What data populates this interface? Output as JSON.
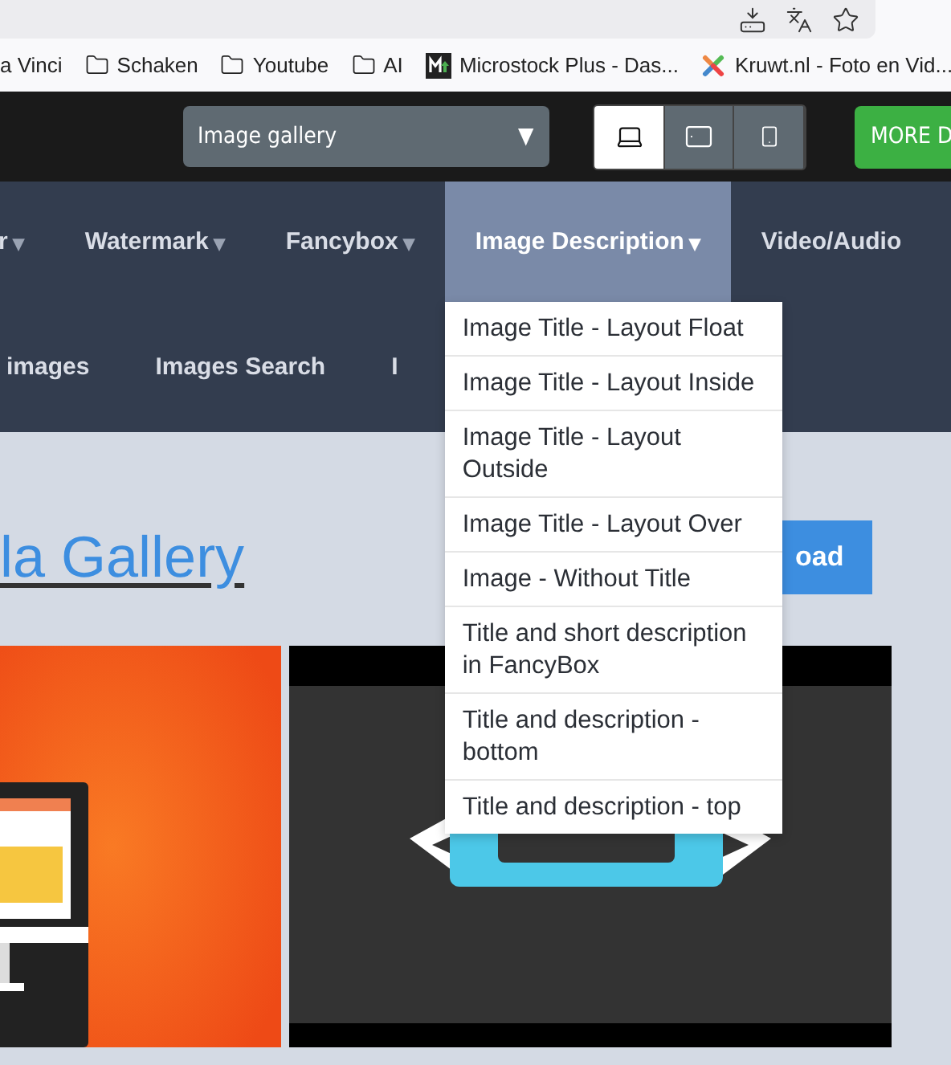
{
  "bookmarks": [
    {
      "kind": "text",
      "label": "a Vinci"
    },
    {
      "kind": "folder",
      "label": "Schaken"
    },
    {
      "kind": "folder",
      "label": "Youtube"
    },
    {
      "kind": "folder",
      "label": "AI"
    },
    {
      "kind": "tile",
      "label": "Microstock Plus - Das..."
    },
    {
      "kind": "cross",
      "label": "Kruwt.nl - Foto en Vid..."
    }
  ],
  "header": {
    "select": {
      "value": "Image gallery",
      "caret": "▼"
    },
    "devices": [
      {
        "kind": "laptop",
        "selected": true
      },
      {
        "kind": "tablet",
        "selected": false
      },
      {
        "kind": "phone",
        "selected": false
      }
    ],
    "more_button": "MORE D"
  },
  "nav": {
    "row_1": [
      {
        "label": "r",
        "caret": "▾",
        "selected": false
      },
      {
        "label": "Watermark",
        "caret": "▾",
        "selected": false
      },
      {
        "label": "Fancybox",
        "caret": "▾",
        "selected": false
      },
      {
        "label": "Image Description",
        "caret": "▾",
        "selected": true
      },
      {
        "label": "Video/Audio",
        "selected": false
      }
    ],
    "row_2": [
      {
        "label": "images"
      },
      {
        "label": "Images Search"
      },
      {
        "label": "I"
      }
    ],
    "dropdown": [
      "Image Title - Layout Float",
      "Image Title - Layout Inside",
      "Image Title - Layout Outside",
      "Image Title - Layout Over",
      "Image - Without Title",
      "Title and short description in FancyBox",
      "Title and description - bottom",
      "Title and description - top"
    ]
  },
  "content": {
    "title": "la Gallery",
    "button": "oad"
  }
}
